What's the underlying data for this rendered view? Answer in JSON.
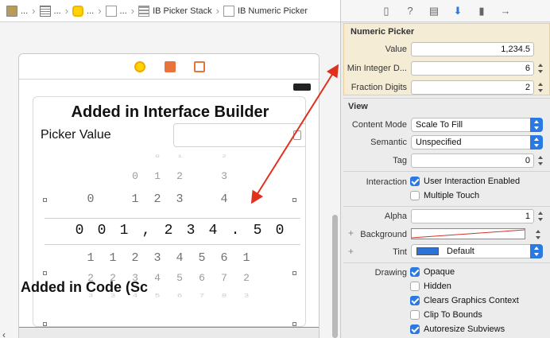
{
  "breadcrumb": {
    "items": [
      {
        "label": "...",
        "icon": "storyboard-file-icon"
      },
      {
        "label": "...",
        "icon": "window-scene-icon"
      },
      {
        "label": "...",
        "icon": "view-controller-icon"
      },
      {
        "label": "...",
        "icon": "view-icon"
      },
      {
        "label": "IB Picker Stack",
        "icon": "stack-view-icon"
      },
      {
        "label": "IB Numeric Picker",
        "icon": "view-icon"
      }
    ]
  },
  "canvas": {
    "heading": "Added in Interface Builder",
    "picker_label": "Picker Value",
    "value_field_text": "",
    "below_heading": "Added in Code (Sc",
    "picker_rows": [
      [
        "",
        "",
        "",
        "0",
        "1",
        "",
        "2"
      ],
      [
        "",
        "",
        "0",
        "1",
        "2",
        "",
        "3"
      ],
      [
        "0",
        "",
        "1",
        "2",
        "3",
        "",
        "4"
      ],
      [
        "0",
        "0",
        "1",
        ",",
        "2",
        "3",
        "4",
        ".",
        "5",
        "0"
      ],
      [
        "1",
        "1",
        "2",
        "3",
        "4",
        "5",
        "6",
        "1"
      ],
      [
        "2",
        "2",
        "3",
        "4",
        "5",
        "6",
        "7",
        "2"
      ],
      [
        "3",
        "3",
        "4",
        "5",
        "6",
        "7",
        "8",
        "3"
      ]
    ]
  },
  "inspector": {
    "tabs": [
      "file-icon",
      "help-icon",
      "identity-icon",
      "attributes-icon",
      "size-icon",
      "connections-icon"
    ],
    "active_tab": "attributes-icon",
    "numeric_picker": {
      "title": "Numeric Picker",
      "value_label": "Value",
      "value": "1,234.5",
      "min_integer_label": "Min Integer D...",
      "min_integer": "6",
      "fraction_label": "Fraction Digits",
      "fraction": "2"
    },
    "view": {
      "title": "View",
      "content_mode_label": "Content Mode",
      "content_mode": "Scale To Fill",
      "semantic_label": "Semantic",
      "semantic": "Unspecified",
      "tag_label": "Tag",
      "tag": "0",
      "interaction_label": "Interaction",
      "user_interaction": "User Interaction Enabled",
      "multiple_touch": "Multiple Touch",
      "alpha_label": "Alpha",
      "alpha": "1",
      "background_label": "Background",
      "tint_label": "Tint",
      "tint": "Default",
      "tint_color": "#2a73d8",
      "drawing_label": "Drawing",
      "opaque": "Opaque",
      "hidden": "Hidden",
      "clears": "Clears Graphics Context",
      "clip": "Clip To Bounds",
      "autoresize": "Autoresize Subviews"
    }
  },
  "colors": {
    "accent": "#2a7ae2",
    "arrow": "#e0311f",
    "highlight_section": "#f5ecd6"
  }
}
